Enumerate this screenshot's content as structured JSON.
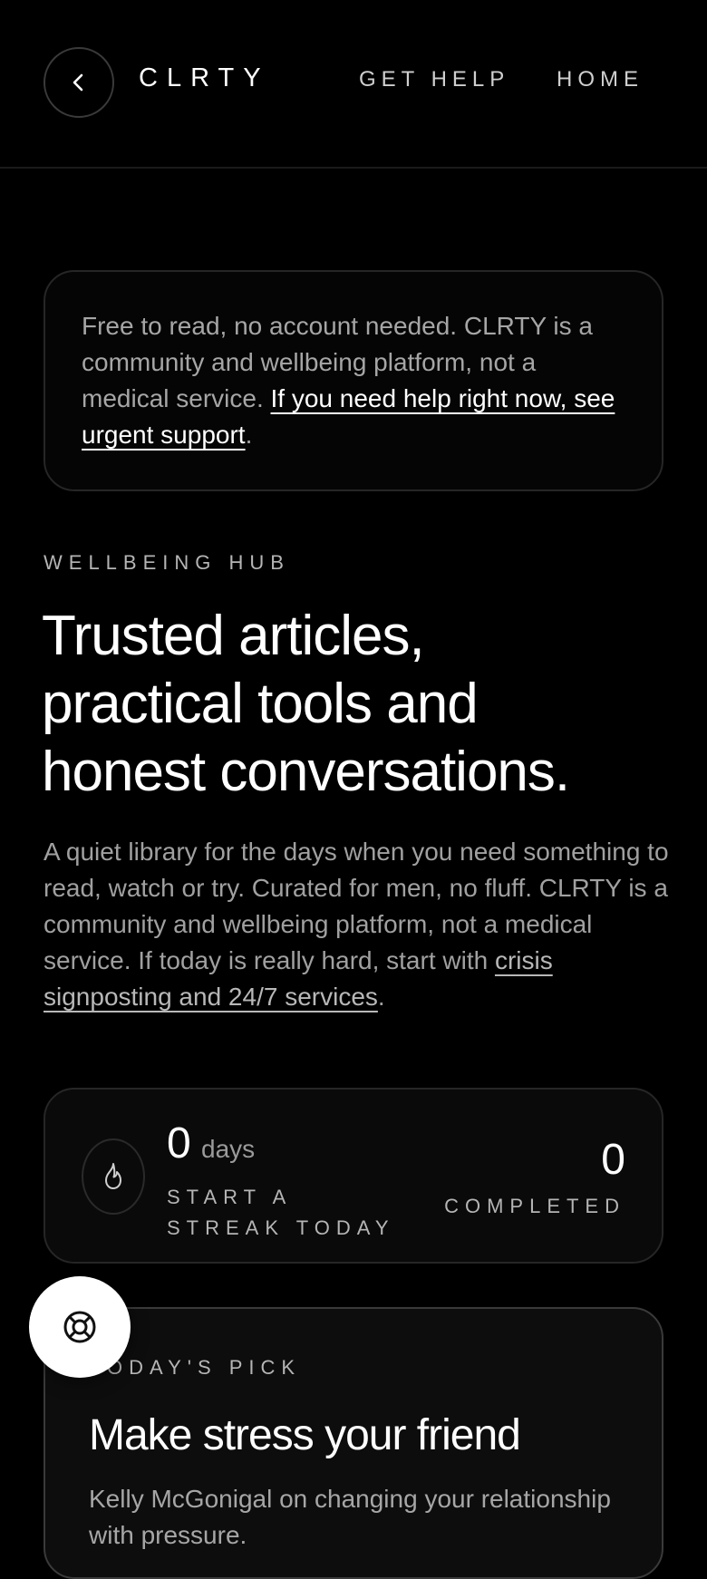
{
  "header": {
    "logo": "CLRTY",
    "nav": {
      "get_help": "GET HELP",
      "home": "HOME"
    },
    "back_icon": "chevron-left-icon"
  },
  "notice": {
    "text": "Free to read, no account needed. CLRTY is a community and wellbeing platform, not a medical service. ",
    "link": "If you need help right now, see urgent support",
    "suffix": "."
  },
  "hub": {
    "eyebrow": "WELLBEING HUB",
    "headline_line1": "Trusted articles,",
    "headline_line2": "practical tools and",
    "headline_line3": "honest conversations.",
    "intro": "A quiet library for the days when you need something to read, watch or try. Curated for men, no fluff. CLRTY is a community and wellbeing platform, not a medical service. If today is really hard, start with ",
    "intro_link": "crisis signposting and 24/7 services",
    "intro_suffix": "."
  },
  "streak": {
    "icon": "flame-icon",
    "count": "0",
    "unit": "days",
    "label": "START A STREAK TODAY",
    "completed_count": "0",
    "completed_label": "COMPLETED"
  },
  "pick": {
    "eyebrow": "TODAY'S PICK",
    "title": "Make stress your friend",
    "description": "Kelly McGonigal on changing your relationship with pressure."
  },
  "fab": {
    "icon": "lifebuoy-icon"
  },
  "colors": {
    "background": "#000000",
    "text": "#ffffff",
    "muted": "#a6a6a6",
    "border": "#262626"
  }
}
